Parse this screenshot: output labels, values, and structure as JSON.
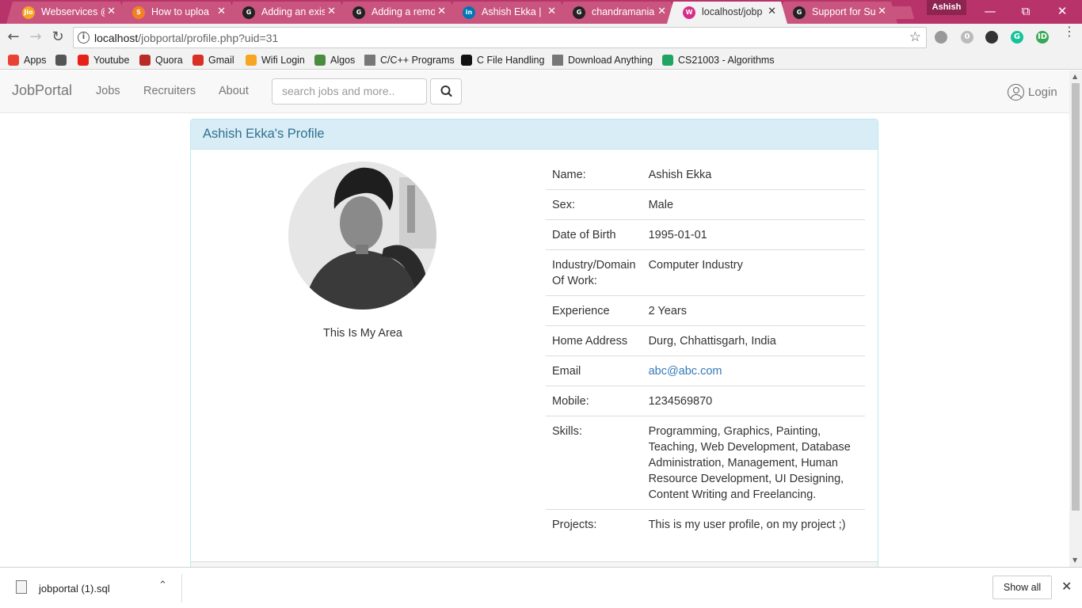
{
  "browser": {
    "tabs": [
      {
        "title": "Webservices @",
        "favicon": "jio-icon",
        "color": "#f5a623",
        "glyph": "Jio"
      },
      {
        "title": "How to uploa",
        "favicon": "stackoverflow-icon",
        "color": "#f48024",
        "glyph": "S"
      },
      {
        "title": "Adding an exis",
        "favicon": "github-icon",
        "color": "#222222",
        "glyph": "G"
      },
      {
        "title": "Adding a remo",
        "favicon": "github-icon",
        "color": "#222222",
        "glyph": "G"
      },
      {
        "title": "Ashish Ekka | L",
        "favicon": "linkedin-icon",
        "color": "#0077b5",
        "glyph": "in"
      },
      {
        "title": "chandramania",
        "favicon": "github-icon",
        "color": "#222222",
        "glyph": "G"
      },
      {
        "title": "localhost/jobp",
        "favicon": "localhost-icon",
        "color": "#d62f8a",
        "glyph": "W"
      },
      {
        "title": "Support for Su",
        "favicon": "github-icon",
        "color": "#222222",
        "glyph": "G"
      }
    ],
    "active_tab_index": 6,
    "profile_name": "Ashish",
    "url_host": "localhost",
    "url_path": "/jobportal/profile.php?uid=31",
    "bookmarks": [
      {
        "label": "Apps",
        "icon": "apps-grid-icon",
        "color": "#e94235"
      },
      {
        "label": "",
        "icon": "history-icon",
        "color": "#555555"
      },
      {
        "label": "Youtube",
        "icon": "youtube-icon",
        "color": "#e62117"
      },
      {
        "label": "Quora",
        "icon": "quora-icon",
        "color": "#b92b27"
      },
      {
        "label": "Gmail",
        "icon": "gmail-icon",
        "color": "#d93025"
      },
      {
        "label": "Wifi Login",
        "icon": "jio-icon",
        "color": "#f5a623"
      },
      {
        "label": "Algos",
        "icon": "algos-icon",
        "color": "#4a8c3f"
      },
      {
        "label": "C/C++ Programs",
        "icon": "page-icon",
        "color": "#777777"
      },
      {
        "label": "C File Handling",
        "icon": "sf-icon",
        "color": "#111111"
      },
      {
        "label": "Download Anything",
        "icon": "page-icon",
        "color": "#777777"
      },
      {
        "label": "CS21003 - Algorithms",
        "icon": "drive-icon",
        "color": "#1fa463"
      }
    ]
  },
  "site": {
    "brand": "JobPortal",
    "nav": [
      "Jobs",
      "Recruiters",
      "About"
    ],
    "search_placeholder": "search jobs and more..",
    "login_label": "Login"
  },
  "profile": {
    "heading": "Ashish Ekka's Profile",
    "caption": "This Is My Area",
    "fields": [
      {
        "label": "Name:",
        "value": "Ashish Ekka"
      },
      {
        "label": "Sex:",
        "value": "Male"
      },
      {
        "label": "Date of Birth",
        "value": "1995-01-01"
      },
      {
        "label": "Industry/Domain Of Work:",
        "value": "Computer Industry"
      },
      {
        "label": "Experience",
        "value": "2 Years"
      },
      {
        "label": "Home Address",
        "value": "Durg, Chhattisgarh, India"
      },
      {
        "label": "Email",
        "value": "abc@abc.com"
      },
      {
        "label": "Mobile:",
        "value": "1234569870"
      },
      {
        "label": "Skills:",
        "value": "Programming, Graphics, Painting, Teaching, Web Development, Database Administration, Management, Human Resource Development, UI Designing, Content Writing and Freelancing."
      },
      {
        "label": "Projects:",
        "value": "This is my user profile, on my project ;)"
      }
    ]
  },
  "downloads": {
    "file_name": "jobportal (1).sql",
    "show_all_label": "Show all"
  }
}
